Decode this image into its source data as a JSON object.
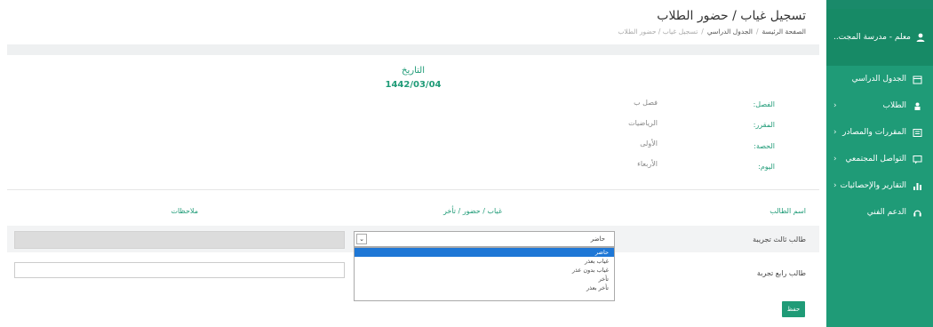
{
  "header": {
    "title": "تسجيل غياب / حضور الطلاب",
    "breadcrumb": [
      "الصفحة الرئيسة",
      "الجدول الدراسي",
      "تسجيل غياب / حضور الطلاب"
    ],
    "breadcrumb_sep": "/"
  },
  "sidebar": {
    "user": "معلم - مدرسة المجت..",
    "items": [
      {
        "label": "الجدول الدراسي",
        "icon": "calendar-icon",
        "chevron": false
      },
      {
        "label": "الطلاب",
        "icon": "student-icon",
        "chevron": true
      },
      {
        "label": "المقررات والمصادر",
        "icon": "courses-icon",
        "chevron": true
      },
      {
        "label": "التواصل المجتمعي",
        "icon": "chat-icon",
        "chevron": true
      },
      {
        "label": "التقارير والإحصائيات",
        "icon": "chart-icon",
        "chevron": true
      },
      {
        "label": "الدعم الفني",
        "icon": "headset-icon",
        "chevron": false
      }
    ]
  },
  "info": {
    "date_label": "التاريخ",
    "date_value": "1442/03/04",
    "rows": [
      {
        "label": "الفصل:",
        "value": "فصل ب"
      },
      {
        "label": "المقرر:",
        "value": "الرياضيات"
      },
      {
        "label": "الحصة:",
        "value": "الأولى"
      },
      {
        "label": "اليوم:",
        "value": "الأربعاء"
      }
    ]
  },
  "table": {
    "headers": {
      "name": "اسم الطالب",
      "status": "غياب / حضور / تأخر",
      "notes": "ملاحظات"
    },
    "rows": [
      {
        "name": "طالب ثالث تجريبة",
        "status": "حاضر"
      },
      {
        "name": "طالب رابع تجربة"
      }
    ]
  },
  "dropdown": {
    "options": [
      "حاضر",
      "غياب بعذر",
      "غياب بدون عذر",
      "تأخر",
      "تأخر بعذر"
    ],
    "selected_index": 0
  },
  "actions": {
    "save": "حفظ"
  },
  "colors": {
    "accent": "#1f9b77",
    "selection": "#1e77d6"
  }
}
